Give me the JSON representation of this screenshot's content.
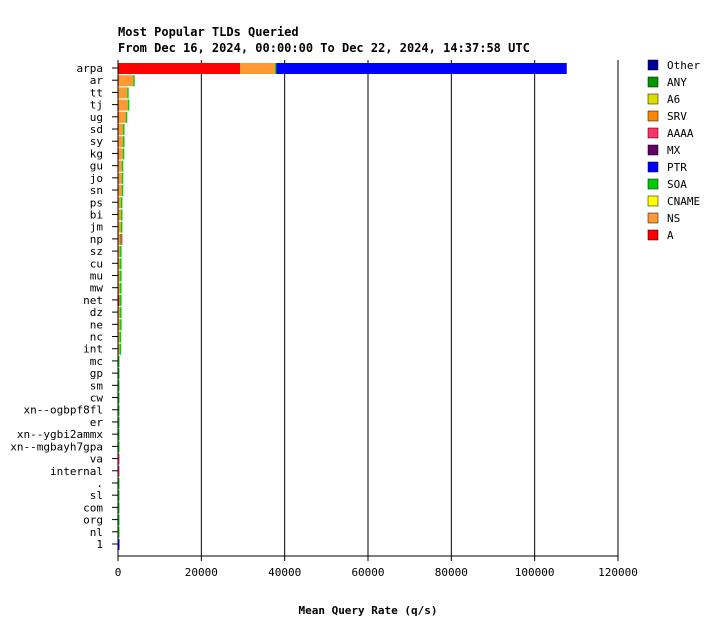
{
  "chart_data": {
    "type": "bar",
    "orientation": "horizontal",
    "stacked": true,
    "title": "Most Popular TLDs Queried",
    "subtitle": "From Dec 16, 2024, 00:00:00 To Dec 22, 2024, 14:37:58 UTC",
    "xlabel": "Mean Query Rate (q/s)",
    "ylabel": "",
    "xlim": [
      0,
      120000
    ],
    "xticks": [
      0,
      20000,
      40000,
      60000,
      80000,
      100000,
      120000
    ],
    "grid": "vertical",
    "legend": "right",
    "categories": [
      "arpa",
      "ar",
      "tt",
      "tj",
      "ug",
      "sd",
      "sy",
      "kg",
      "gu",
      "jo",
      "sn",
      "ps",
      "bi",
      "jm",
      "np",
      "sz",
      "cu",
      "mu",
      "mw",
      "net",
      "dz",
      "ne",
      "nc",
      "int",
      "mc",
      "gp",
      "sm",
      "cw",
      "xn--ogbpf8fl",
      "er",
      "xn--ygbi2ammx",
      "xn--mgbayh7gpa",
      "va",
      "internal",
      ".",
      "sl",
      "com",
      "org",
      "nl",
      "1"
    ],
    "series": [
      {
        "name": "A",
        "color": "#ff0000",
        "values": [
          29300,
          150,
          0,
          150,
          150,
          0,
          0,
          150,
          0,
          0,
          0,
          0,
          0,
          0,
          0,
          0,
          0,
          0,
          0,
          300,
          0,
          100,
          0,
          0,
          0,
          0,
          0,
          0,
          0,
          0,
          0,
          0,
          0,
          0,
          0,
          0,
          0,
          0,
          0,
          0
        ]
      },
      {
        "name": "NS",
        "color": "#ff9933",
        "values": [
          8400,
          3500,
          2200,
          2200,
          1700,
          1200,
          1200,
          1000,
          900,
          900,
          900,
          700,
          700,
          700,
          500,
          500,
          500,
          500,
          500,
          200,
          500,
          400,
          400,
          400,
          0,
          0,
          0,
          0,
          0,
          0,
          0,
          0,
          0,
          0,
          0,
          0,
          0,
          0,
          0,
          0
        ]
      },
      {
        "name": "CNAME",
        "color": "#ffff00",
        "values": [
          0,
          0,
          0,
          0,
          0,
          0,
          0,
          0,
          0,
          0,
          0,
          0,
          0,
          0,
          0,
          0,
          0,
          0,
          0,
          0,
          0,
          0,
          0,
          0,
          0,
          0,
          0,
          0,
          0,
          0,
          0,
          0,
          0,
          0,
          0,
          0,
          0,
          0,
          0,
          0
        ]
      },
      {
        "name": "SOA",
        "color": "#00cc00",
        "values": [
          300,
          200,
          200,
          200,
          300,
          200,
          200,
          200,
          300,
          300,
          300,
          200,
          200,
          300,
          200,
          300,
          300,
          300,
          300,
          300,
          300,
          300,
          100,
          100,
          150,
          150,
          150,
          150,
          150,
          150,
          150,
          150,
          0,
          0,
          150,
          150,
          150,
          150,
          150,
          0
        ]
      },
      {
        "name": "PTR",
        "color": "#0000ff",
        "values": [
          69700,
          0,
          0,
          0,
          0,
          0,
          0,
          0,
          0,
          0,
          0,
          0,
          0,
          0,
          0,
          0,
          0,
          0,
          0,
          0,
          0,
          0,
          0,
          0,
          0,
          0,
          0,
          0,
          0,
          0,
          0,
          0,
          0,
          0,
          0,
          0,
          0,
          0,
          0,
          150
        ]
      },
      {
        "name": "MX",
        "color": "#660066",
        "values": [
          0,
          0,
          0,
          0,
          0,
          0,
          0,
          0,
          0,
          0,
          0,
          0,
          0,
          0,
          0,
          0,
          0,
          0,
          0,
          0,
          0,
          0,
          0,
          0,
          0,
          0,
          0,
          0,
          0,
          0,
          0,
          0,
          0,
          0,
          0,
          0,
          0,
          0,
          0,
          0
        ]
      },
      {
        "name": "AAAA",
        "color": "#ff3366",
        "values": [
          0,
          0,
          0,
          0,
          0,
          0,
          0,
          0,
          0,
          0,
          0,
          0,
          0,
          0,
          300,
          0,
          0,
          0,
          0,
          0,
          0,
          0,
          0,
          0,
          0,
          0,
          0,
          0,
          0,
          0,
          0,
          0,
          150,
          150,
          0,
          0,
          0,
          0,
          0,
          0
        ]
      },
      {
        "name": "SRV",
        "color": "#ff8800",
        "values": [
          0,
          0,
          0,
          0,
          0,
          0,
          0,
          0,
          0,
          0,
          0,
          0,
          0,
          0,
          0,
          0,
          0,
          0,
          0,
          0,
          0,
          0,
          0,
          0,
          0,
          0,
          0,
          0,
          0,
          0,
          0,
          0,
          0,
          0,
          0,
          0,
          0,
          0,
          0,
          0
        ]
      },
      {
        "name": "A6",
        "color": "#dddd00",
        "values": [
          0,
          0,
          0,
          0,
          0,
          0,
          0,
          0,
          0,
          0,
          0,
          0,
          0,
          0,
          0,
          0,
          0,
          0,
          0,
          0,
          0,
          0,
          0,
          0,
          0,
          0,
          0,
          0,
          0,
          0,
          0,
          0,
          0,
          0,
          0,
          0,
          0,
          0,
          0,
          0
        ]
      },
      {
        "name": "ANY",
        "color": "#009900",
        "values": [
          0,
          0,
          0,
          0,
          0,
          0,
          0,
          0,
          0,
          0,
          0,
          0,
          0,
          0,
          0,
          0,
          0,
          0,
          0,
          0,
          0,
          0,
          0,
          0,
          0,
          0,
          0,
          0,
          0,
          0,
          0,
          0,
          0,
          0,
          0,
          0,
          0,
          0,
          0,
          0
        ]
      },
      {
        "name": "Other",
        "color": "#000099",
        "values": [
          0,
          0,
          0,
          0,
          0,
          0,
          0,
          0,
          0,
          0,
          0,
          0,
          0,
          0,
          0,
          0,
          0,
          0,
          0,
          0,
          0,
          0,
          0,
          0,
          0,
          0,
          0,
          0,
          0,
          0,
          0,
          0,
          0,
          0,
          0,
          0,
          0,
          0,
          0,
          0
        ]
      }
    ],
    "legend_order": [
      "Other",
      "ANY",
      "A6",
      "SRV",
      "AAAA",
      "MX",
      "PTR",
      "SOA",
      "CNAME",
      "NS",
      "A"
    ]
  }
}
